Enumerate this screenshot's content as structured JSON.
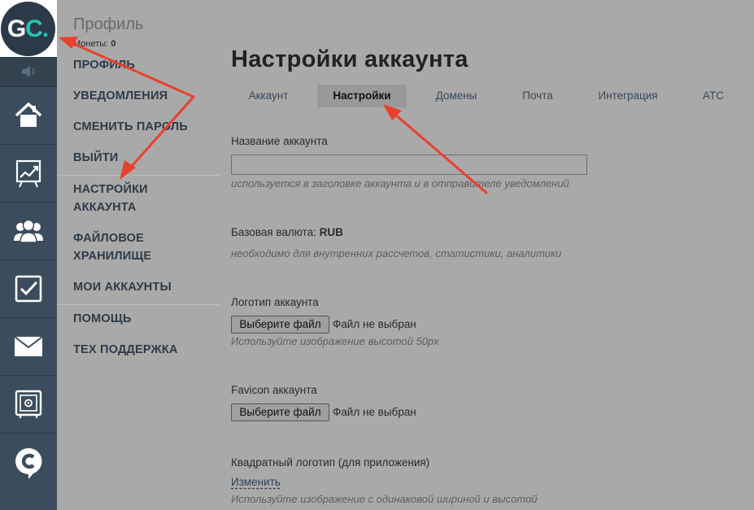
{
  "logo": {
    "g": "G",
    "c": "C",
    "dot": "."
  },
  "menu": {
    "title": "Профиль",
    "coins_label": "Монеты:",
    "coins_value": "0",
    "items": [
      {
        "label": "ПРОФИЛЬ"
      },
      {
        "label": "УВЕДОМЛЕНИЯ"
      },
      {
        "label": "СМЕНИТЬ ПАРОЛЬ"
      },
      {
        "label": "ВЫЙТИ"
      },
      {
        "label": "НАСТРОЙКИ\nАККАУНТА"
      },
      {
        "label": "ФАЙЛОВОЕ\nХРАНИЛИЩЕ"
      },
      {
        "label": "МОИ АККАУНТЫ"
      },
      {
        "label": "ПОМОЩЬ"
      },
      {
        "label": "ТЕХ ПОДДЕРЖКА"
      }
    ]
  },
  "rail": {
    "icons": [
      "speaker-icon",
      "home-icon",
      "chart-board-icon",
      "users-icon",
      "checkbox-icon",
      "mail-icon",
      "safe-icon",
      "chat-c-icon"
    ]
  },
  "page": {
    "title": "Настройки аккаунта",
    "tabs": [
      {
        "label": "Аккаунт",
        "active": false
      },
      {
        "label": "Настройки",
        "active": true
      },
      {
        "label": "Домены",
        "active": false
      },
      {
        "label": "Почта",
        "active": false
      },
      {
        "label": "Интеграция",
        "active": false
      },
      {
        "label": "АТС",
        "active": false
      }
    ]
  },
  "form": {
    "account_name": {
      "label": "Название аккаунта",
      "value": "",
      "hint": "используется в заголовке аккаунта и в отправителе уведомлений"
    },
    "currency": {
      "label": "Базовая валюта:",
      "value": "RUB",
      "hint": "необходимо для внутренних рассчетов, статистики, аналитики"
    },
    "logo": {
      "label": "Логотип аккаунта",
      "button": "Выберите файл",
      "file_status": "Файл не выбран",
      "hint": "Используйте изображение высотой 50px"
    },
    "favicon": {
      "label": "Favicon аккаунта",
      "button": "Выберите файл",
      "file_status": "Файл не выбран"
    },
    "square_logo": {
      "label": "Квадратный логотип (для приложения)",
      "link": "Изменить",
      "hint": "Используйте изображение с одинаковой шириной и высотой"
    }
  },
  "colors": {
    "rail_bg": "#3b4d5d",
    "overlay_bg": "#a9a9a9",
    "accent_teal": "#27c3b0",
    "annotation_arrow": "#e8412c"
  }
}
